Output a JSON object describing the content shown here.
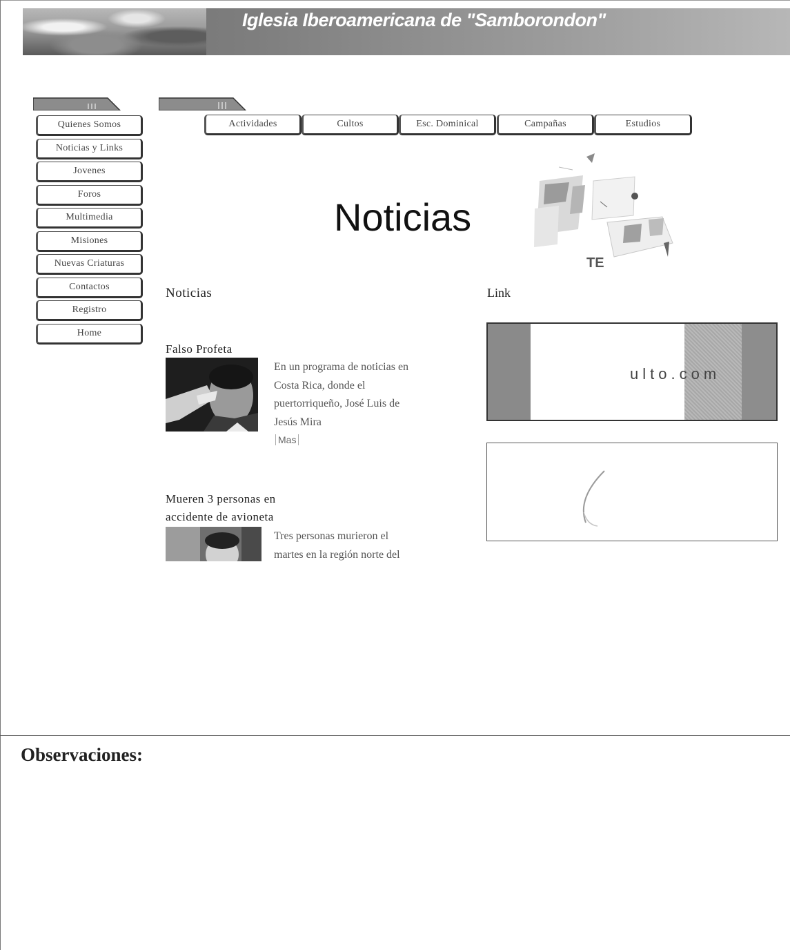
{
  "banner": {
    "title": "Iglesia Iberoamericana de \"Samborondon\""
  },
  "sidebar": {
    "items": [
      {
        "label": "Quienes Somos"
      },
      {
        "label": "Noticias y Links"
      },
      {
        "label": "Jovenes"
      },
      {
        "label": "Foros"
      },
      {
        "label": "Multimedia"
      },
      {
        "label": "Misiones"
      },
      {
        "label": "Nuevas Criaturas"
      },
      {
        "label": "Contactos"
      },
      {
        "label": "Registro"
      },
      {
        "label": "Home"
      }
    ]
  },
  "topnav": {
    "items": [
      {
        "label": "Actividades"
      },
      {
        "label": "Cultos"
      },
      {
        "label": "Esc. Dominical"
      },
      {
        "label": "Campañas"
      },
      {
        "label": "Estudios"
      }
    ]
  },
  "main": {
    "page_title": "Noticias",
    "news_heading": "Noticias",
    "link_heading": "Link",
    "news": [
      {
        "title": "Falso Profeta",
        "lines": [
          "En un programa de noticias en",
          "Costa Rica, donde el",
          "puertorriqueño, José Luis de",
          "Jesús Mira"
        ],
        "more": "Mas"
      },
      {
        "title_lines": [
          "Mueren 3 personas en",
          "accidente de avioneta"
        ],
        "lines": [
          "Tres personas murieron el",
          "martes en la región norte del"
        ]
      }
    ],
    "link_banner_text": "ulto.com"
  },
  "footer": {
    "observaciones": "Observaciones:"
  }
}
